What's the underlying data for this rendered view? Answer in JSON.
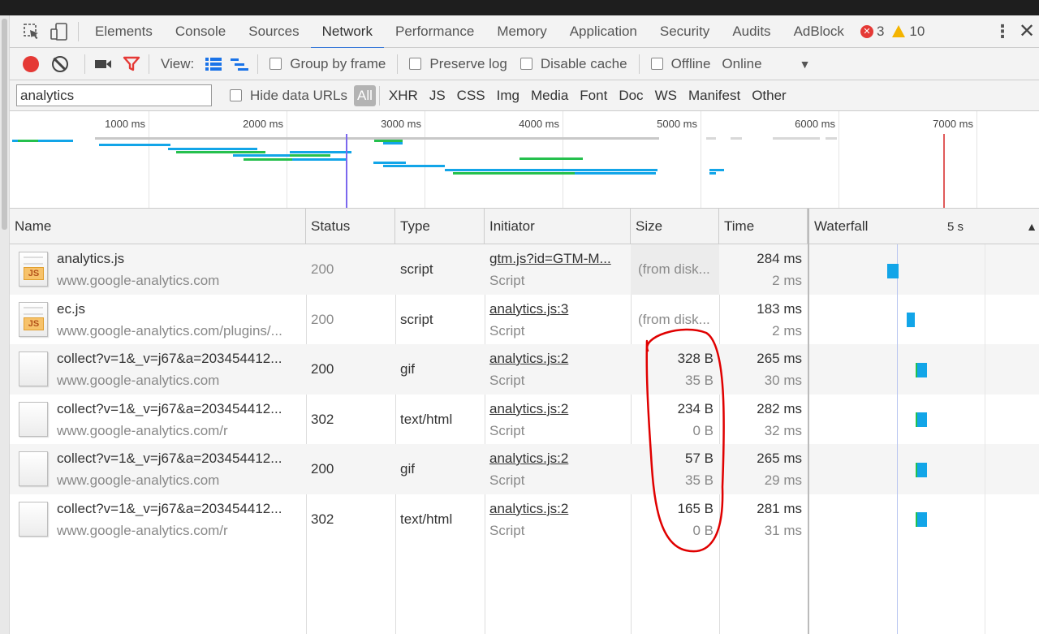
{
  "tabs": {
    "items": [
      "Elements",
      "Console",
      "Sources",
      "Network",
      "Performance",
      "Memory",
      "Application",
      "Security",
      "Audits",
      "AdBlock"
    ],
    "active": "Network",
    "error_count": "3",
    "warning_count": "10"
  },
  "toolbar": {
    "view_label": "View:",
    "group_by_frame": "Group by frame",
    "preserve_log": "Preserve log",
    "disable_cache": "Disable cache",
    "offline": "Offline",
    "throttling": "Online"
  },
  "filter": {
    "value": "analytics",
    "hide_data_urls": "Hide data URLs",
    "types": [
      "All",
      "XHR",
      "JS",
      "CSS",
      "Img",
      "Media",
      "Font",
      "Doc",
      "WS",
      "Manifest",
      "Other"
    ],
    "active_type": "All"
  },
  "overview": {
    "ticks": [
      "1000 ms",
      "2000 ms",
      "3000 ms",
      "4000 ms",
      "5000 ms",
      "6000 ms",
      "7000 ms"
    ]
  },
  "table": {
    "columns": [
      "Name",
      "Status",
      "Type",
      "Initiator",
      "Size",
      "Time",
      "Waterfall"
    ],
    "waterfall_scale": "5 s",
    "rows": [
      {
        "icon": "js-file-icon",
        "name": "analytics.js",
        "host": "www.google-analytics.com",
        "status": "200",
        "type": "script",
        "initiator": "gtm.js?id=GTM-M...",
        "initiator_type": "Script",
        "size": "(from disk...",
        "content_size": "",
        "time": "284 ms",
        "latency": "2 ms"
      },
      {
        "icon": "js-file-icon",
        "name": "ec.js",
        "host": "www.google-analytics.com/plugins/...",
        "status": "200",
        "type": "script",
        "initiator": "analytics.js:3",
        "initiator_type": "Script",
        "size": "(from disk...",
        "content_size": "",
        "time": "183 ms",
        "latency": "2 ms"
      },
      {
        "icon": "blank-file-icon",
        "name": "collect?v=1&_v=j67&a=203454412...",
        "host": "www.google-analytics.com",
        "status": "200",
        "type": "gif",
        "initiator": "analytics.js:2",
        "initiator_type": "Script",
        "size": "328 B",
        "content_size": "35 B",
        "time": "265 ms",
        "latency": "30 ms"
      },
      {
        "icon": "blank-file-icon",
        "name": "collect?v=1&_v=j67&a=203454412...",
        "host": "www.google-analytics.com/r",
        "status": "302",
        "type": "text/html",
        "initiator": "analytics.js:2",
        "initiator_type": "Script",
        "size": "234 B",
        "content_size": "0 B",
        "time": "282 ms",
        "latency": "32 ms"
      },
      {
        "icon": "blank-file-icon",
        "name": "collect?v=1&_v=j67&a=203454412...",
        "host": "www.google-analytics.com",
        "status": "200",
        "type": "gif",
        "initiator": "analytics.js:2",
        "initiator_type": "Script",
        "size": "57 B",
        "content_size": "35 B",
        "time": "265 ms",
        "latency": "29 ms"
      },
      {
        "icon": "blank-file-icon",
        "name": "collect?v=1&_v=j67&a=203454412...",
        "host": "www.google-analytics.com/r",
        "status": "302",
        "type": "text/html",
        "initiator": "analytics.js:2",
        "initiator_type": "Script",
        "size": "165 B",
        "content_size": "0 B",
        "time": "281 ms",
        "latency": "31 ms"
      }
    ]
  },
  "colors": {
    "accent": "#3879d9",
    "record": "#e53935",
    "bar_blue": "#12a5e8",
    "bar_green": "#25c04d",
    "annotation": "#e00000"
  }
}
